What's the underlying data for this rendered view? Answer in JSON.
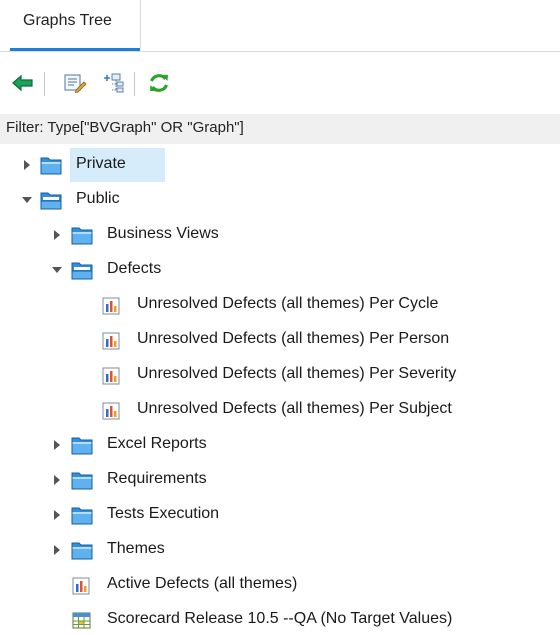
{
  "tab": {
    "label": "Graphs Tree"
  },
  "toolbar": {
    "buttons": [
      {
        "icon": "back-arrow-icon"
      },
      {
        "icon": "edit-icon"
      },
      {
        "icon": "tree-expand-icon"
      },
      {
        "icon": "refresh-icon"
      }
    ]
  },
  "filter": {
    "text": "Filter: Type[\"BVGraph\" OR \"Graph\"]"
  },
  "tree": {
    "private": "Private",
    "public": "Public",
    "business_views": "Business Views",
    "defects": "Defects",
    "defect_graphs": [
      "Unresolved Defects (all themes) Per Cycle",
      "Unresolved Defects (all themes) Per Person",
      "Unresolved Defects (all themes) Per Severity",
      "Unresolved Defects (all themes) Per Subject"
    ],
    "excel_reports": "Excel Reports",
    "requirements": "Requirements",
    "tests_execution": "Tests Execution",
    "themes": "Themes",
    "active_defects": "Active Defects (all themes)",
    "scorecard": "Scorecard Release 10.5 --QA (No Target Values)"
  },
  "colors": {
    "accent": "#1e7fd8",
    "selection": "#d6ecfb",
    "folder": "#2f8fe0",
    "refresh": "#2aa52a",
    "back_arrow": "#1aa35a"
  }
}
